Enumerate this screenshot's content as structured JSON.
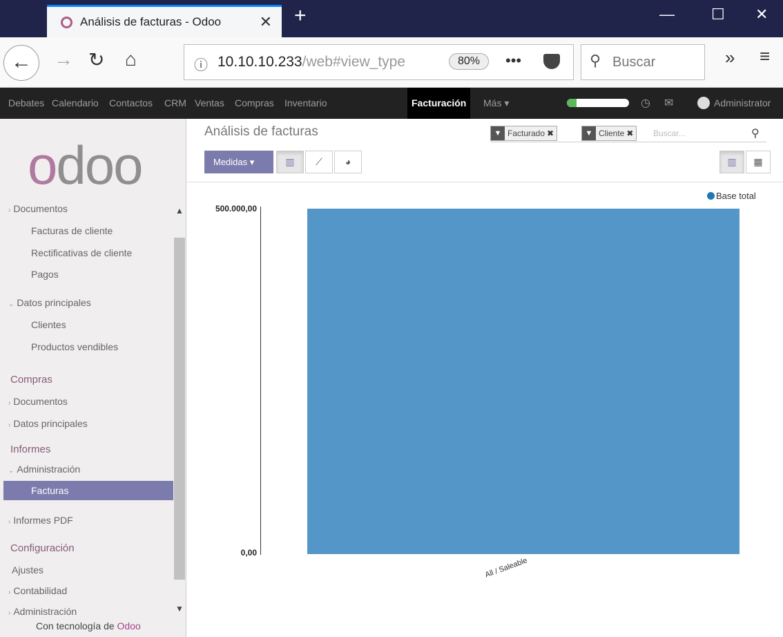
{
  "browser": {
    "tab_title": "Análisis de facturas - Odoo",
    "tab_close": "✕",
    "new_tab": "+",
    "min": "—",
    "max": "☐",
    "close": "✕",
    "url_host": "10.10.10.233",
    "url_path": "/web#view_type",
    "zoom": "80%",
    "search_placeholder": "Buscar",
    "more": "»",
    "menu": "≡"
  },
  "app_menu": {
    "items": [
      "Debates",
      "Calendario",
      "Contactos",
      "CRM",
      "Ventas",
      "Compras",
      "Inventario",
      "Facturación",
      "Más ▾"
    ],
    "active": "Facturación",
    "progress": 0.15,
    "user": "Administrator"
  },
  "sidebar": {
    "logo": "odoo",
    "items": [
      {
        "label": "Documentos",
        "type": "toggle"
      },
      {
        "label": "Facturas de cliente",
        "type": "sub"
      },
      {
        "label": "Rectificativas de cliente",
        "type": "sub"
      },
      {
        "label": "Pagos",
        "type": "sub"
      },
      {
        "label": "Datos principales",
        "type": "toggle-open"
      },
      {
        "label": "Clientes",
        "type": "sub"
      },
      {
        "label": "Productos vendibles",
        "type": "sub"
      },
      {
        "label": "Compras",
        "type": "head"
      },
      {
        "label": "Documentos",
        "type": "toggle"
      },
      {
        "label": "Datos principales",
        "type": "toggle"
      },
      {
        "label": "Informes",
        "type": "head"
      },
      {
        "label": "Administración",
        "type": "toggle-open"
      },
      {
        "label": "Facturas",
        "type": "selected"
      },
      {
        "label": "Informes PDF",
        "type": "toggle"
      },
      {
        "label": "Configuración",
        "type": "head"
      },
      {
        "label": "Ajustes",
        "type": "plain"
      },
      {
        "label": "Contabilidad",
        "type": "toggle"
      },
      {
        "label": "Administración",
        "type": "toggle"
      }
    ],
    "powered_prefix": "Con tecnología de",
    "powered_brand": "Odoo"
  },
  "control_panel": {
    "title": "Análisis de facturas",
    "measures_label": "Medidas ▾",
    "facets": [
      "Facturado",
      "Cliente"
    ],
    "search_placeholder": "Buscar..."
  },
  "chart_data": {
    "type": "bar",
    "categories": [
      "All / Saleable"
    ],
    "series": [
      {
        "name": "Base total",
        "values": [
          500000
        ]
      }
    ],
    "ytick_labels": [
      "500.000,00",
      "0,00"
    ],
    "ylim": [
      0,
      500000
    ],
    "color": "#5496c8",
    "legend": "top-right"
  }
}
